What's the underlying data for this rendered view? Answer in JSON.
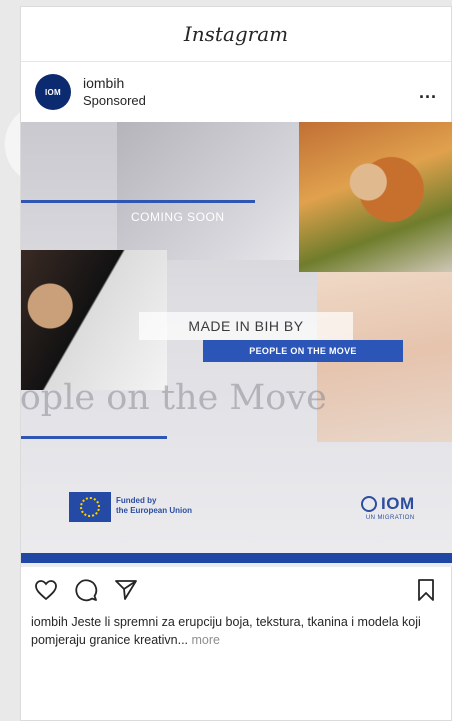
{
  "app": {
    "title": "Instagram"
  },
  "post": {
    "username": "iombih",
    "label": "Sponsored",
    "more_menu": "...",
    "avatar_text": "IOM"
  },
  "media": {
    "coming_soon": "COMING SOON",
    "made_in": "MADE IN BIH BY",
    "people_box": "PEOPLE ON THE MOVE",
    "watermark": "eople on the Move",
    "funded_line1": "Funded by",
    "funded_line2": "the European Union",
    "iom_text": "IOM",
    "iom_sub": "UN MIGRATION"
  },
  "actions": {
    "like": "heart-icon",
    "comment": "comment-icon",
    "share": "share-icon",
    "save": "bookmark-icon"
  },
  "caption": {
    "username": "iombih",
    "text": "Jeste li spremni za erupciju boja, tekstura, tkanina i modela koji pomjeraju granice kreativn...",
    "more": "more"
  },
  "colors": {
    "iom_blue": "#2b55b6",
    "band_blue": "#1f47a3",
    "text": "#262626",
    "muted": "#8e8e8e"
  }
}
